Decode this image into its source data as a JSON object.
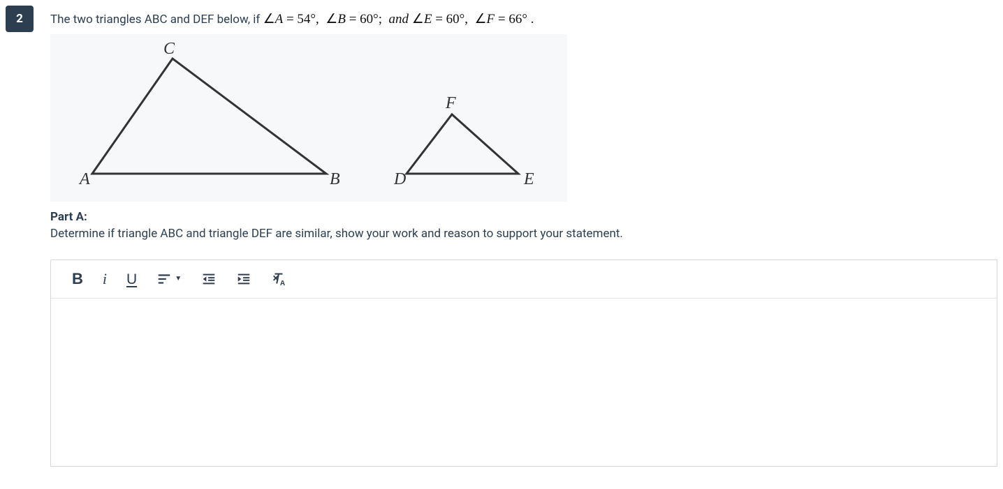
{
  "question": {
    "number": "2",
    "text_prefix": "The two triangles ABC and DEF below, if ",
    "math": "∠A = 54°,  ∠B = 60°;  and ∠E = 60°,  ∠F = 66° .",
    "figure": {
      "labels": {
        "A": "A",
        "B": "B",
        "C": "C",
        "D": "D",
        "E": "E",
        "F": "F"
      }
    },
    "part_label": "Part A:",
    "part_text": "Determine if triangle ABC and triangle DEF are similar, show your work and reason to support your statement."
  },
  "toolbar": {
    "bold": "B",
    "italic": "i",
    "underline": "U"
  }
}
